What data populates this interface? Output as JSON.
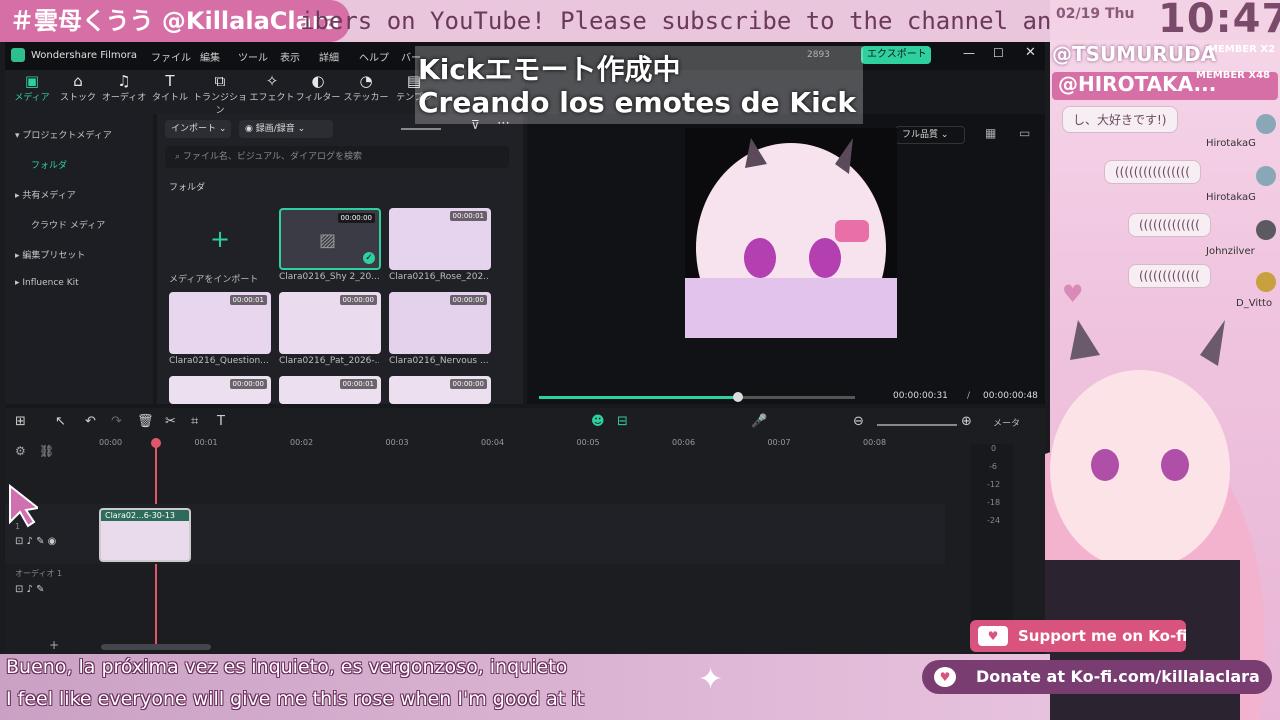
{
  "stream": {
    "handle": "＃雲母くうう @KillalaClara",
    "ticker": "ibers on YouTube! Please subscribe to the channel and follow me on X",
    "date": "02/19 Thu",
    "time": "10:47",
    "members": [
      {
        "name": "@TSUMURUDA",
        "badge": "MEMBER X2"
      },
      {
        "name": "@HIROTAKA...",
        "badge": "MEMBER X48"
      }
    ],
    "chat": [
      {
        "text": "し、大好きです!)",
        "user": "HirotakaG"
      },
      {
        "text": "((((((((((((((((",
        "user": "HirotakaG"
      },
      {
        "text": "(((((((((((((",
        "user": "Johnzilver"
      },
      {
        "text": "(((((((((((((",
        "user": "D_Vitto"
      }
    ],
    "overlay_title": "Kickエモート作成中",
    "overlay_subtitle": "Creando los emotes de Kick",
    "subtitle_es": "Bueno, la próxima vez es inquieto, es vergonzoso, inquieto",
    "subtitle_en": "I feel like everyone will give me this rose when I'm good at it",
    "kofi_support": "Support me on Ko-fi",
    "kofi_donate": "Donate at Ko-fi.com/killalaclara",
    "kofi_icon": "kofi-cup-icon"
  },
  "app": {
    "title": "Wondershare Filmora",
    "menu": [
      "ファイル",
      "編集",
      "ツール",
      "表示",
      "詳細",
      "ヘルプ",
      "バー"
    ],
    "export_label": "エクスポート",
    "credits": "2893",
    "toolbar": [
      {
        "label": "メディア",
        "icon": "media-icon"
      },
      {
        "label": "ストック",
        "icon": "stock-icon"
      },
      {
        "label": "オーディオ",
        "icon": "audio-icon"
      },
      {
        "label": "タイトル",
        "icon": "title-icon"
      },
      {
        "label": "トランジション",
        "icon": "transition-icon"
      },
      {
        "label": "エフェクト",
        "icon": "effect-icon"
      },
      {
        "label": "フィルター",
        "icon": "filter-icon"
      },
      {
        "label": "ステッカー",
        "icon": "sticker-icon"
      },
      {
        "label": "テンプレ",
        "icon": "template-icon"
      }
    ],
    "leftnav": [
      "プロジェクトメディア",
      "フォルダ",
      "共有メディア",
      "クラウド メディア",
      "編集プリセット",
      "Influence Kit"
    ],
    "import_label": "インポート",
    "record_label": "録画/録音",
    "search_placeholder": "ファイル名、ビジュアル、ダイアログを検索",
    "folder_label": "フォルダ",
    "import_media_label": "メディアをインポート",
    "media": [
      {
        "label": "Clara0216_Shy 2_20...",
        "dur": "00:00:00"
      },
      {
        "label": "Clara0216_Rose_202...",
        "dur": "00:00:01"
      },
      {
        "label": "Clara0216_Question...",
        "dur": "00:00:01"
      },
      {
        "label": "Clara0216_Pat_2026-...",
        "dur": "00:00:00"
      },
      {
        "label": "Clara0216_Nervous ...",
        "dur": "00:00:00"
      },
      {
        "label": "",
        "dur": "00:00:00"
      },
      {
        "label": "",
        "dur": "00:00:01"
      },
      {
        "label": "",
        "dur": "00:00:00"
      }
    ],
    "preview": {
      "quality": "フル品質",
      "current": "00:00:00:31",
      "separator": "/",
      "total": "00:00:00:48",
      "progress": 0.63
    },
    "timeline": {
      "ticks": [
        "00:00",
        "00:01",
        "00:02",
        "00:03",
        "00:04",
        "00:05",
        "00:06",
        "00:07",
        "00:08"
      ],
      "meter_label": "メータ",
      "meter_scale": [
        "0",
        "-6",
        "-12",
        "-18",
        "-24"
      ],
      "clip_label": "Clara02...6-30-13",
      "audio_track": "オーディオ 1",
      "video_track": "1"
    }
  }
}
